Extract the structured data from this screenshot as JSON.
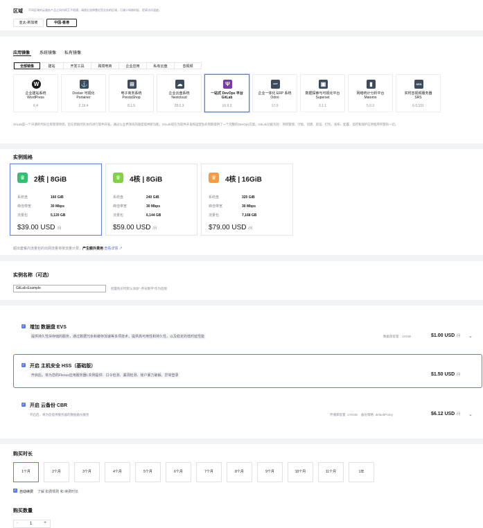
{
  "region": {
    "title": "区域",
    "hint": "不同区域的云服务产品之间内网互不相通；请就近选择靠近您业务的区域，可减少网络时延、提高访问速度。",
    "options": [
      "亚太-新加坡",
      "中国-香港"
    ],
    "selected": "中国-香港"
  },
  "image": {
    "types": [
      "应用镜像",
      "系统镜像",
      "私有镜像"
    ],
    "selected_type": "应用镜像",
    "categories": [
      "全部镜像",
      "建站",
      "开发工具",
      "跨境电商",
      "企业应用",
      "私有云盘",
      "音视频"
    ],
    "selected_category": "全部镜像",
    "items": [
      {
        "name": "企业建站系统",
        "sub": "WordPress",
        "version": "6.4",
        "icon": "wordpress-icon",
        "color": "#191919",
        "glyph": "W"
      },
      {
        "name": "Docker 可视化",
        "sub": "Portainer",
        "version": "2.19.4",
        "icon": "portainer-icon",
        "color": "#3d4b5c",
        "glyph": "⚓"
      },
      {
        "name": "电子商务系统",
        "sub": "PrestaShop",
        "version": "8.1.5",
        "icon": "cart-icon",
        "color": "#3d4b5c",
        "glyph": "🛒"
      },
      {
        "name": "企业云盘系统",
        "sub": "Nextcloud",
        "version": "28.0.3",
        "icon": "cloud-icon",
        "color": "#3d4b5c",
        "glyph": "☁"
      },
      {
        "name": "一站式 DevOps 平台",
        "sub": "GitLab",
        "version": "16.9.3",
        "icon": "gitlab-icon",
        "color": "#7c3aa8",
        "glyph": "Ψ"
      },
      {
        "name": "企业一体化 ERP 系统",
        "sub": "Odoo",
        "version": "17.0",
        "icon": "odoo-icon",
        "color": "#3d4b5c",
        "glyph": "ERP"
      },
      {
        "name": "数据探索与可视化平台",
        "sub": "Superset",
        "version": "3.1.1",
        "icon": "chart-icon",
        "color": "#3d4b5c",
        "glyph": "▣"
      },
      {
        "name": "网络统计分析平台",
        "sub": "Matomo",
        "version": "5.0.3",
        "icon": "analytics-icon",
        "color": "#3d4b5c",
        "glyph": "▮"
      },
      {
        "name": "实时音视频服务器",
        "sub": "SRS",
        "version": "6.0.101",
        "icon": "srs-icon",
        "color": "#3d4b5c",
        "glyph": "SRS"
      }
    ],
    "description": "GitLab是一个开源的代码仓库管理项目，旨在帮助团队协作进行软件开发。通过以业界领先的速度提供新功能，GitLab现在为软件开发和运营生命周期提供了一个完整的DevOps方案。GitLab功能包括：项目管理、计划、创建、验证、打包、发布、配置、监控和保护应用程序所需的一切。"
  },
  "spec": {
    "title": "实例规格",
    "labels": {
      "disk": "系统盘",
      "bandwidth": "峰值带宽",
      "traffic": "流量包",
      "unit": "/月"
    },
    "items": [
      {
        "name": "2核 | 8GiB",
        "disk": "160 GiB",
        "bandwidth": "30 Mbps",
        "traffic": "5,120 GB",
        "price": "$39.00 USD",
        "color": "#2dc26b"
      },
      {
        "name": "4核 | 8GiB",
        "disk": "240 GiB",
        "bandwidth": "30 Mbps",
        "traffic": "6,144 GB",
        "price": "$59.00 USD",
        "color": "#7fd43f"
      },
      {
        "name": "4核 | 16GiB",
        "disk": "320 GiB",
        "bandwidth": "30 Mbps",
        "traffic": "7,168 GB",
        "price": "$79.00 USD",
        "color": "#fa9b3e"
      }
    ],
    "selected": "2核 | 8GiB",
    "note_prefix": "超出套餐内流量包的出网流量将按流量计费，",
    "note_bold": "产生额外费用",
    "note_link": "查看详情"
  },
  "instance_name": {
    "title": "实例名称（可选）",
    "value": "GitLab-Example",
    "hint": "批量购买时默认添加“-序号数字”作为后缀"
  },
  "addons": [
    {
      "title": "增加 数据盘 EVS",
      "desc": "提供持久性块存储的服务，通过数据冗余和缓存加速等多项技术，提供高可用性和持久性，以及稳定的低时延性能",
      "meta": [
        [
          "数据盘容量",
          "10GiB"
        ]
      ],
      "price": "$1.00 USD",
      "unit": "/月",
      "expandable": true
    },
    {
      "title": "开启 主机安全 HSS（基础版）",
      "desc": "开启后，将为您的Flexus应用服务器L实例提供：口令检测、漏洞检测、账户暴力破解、异常登录",
      "meta": [],
      "price": "$1.50 USD",
      "unit": "/月",
      "expandable": false
    },
    {
      "title": "开启 云备份 CBR",
      "desc": "开启后，将为您提供服务器的数据备份服务",
      "meta": [
        [
          "存储库容量",
          "170GiB"
        ],
        [
          "备份策略",
          "defaultPolicy"
        ]
      ],
      "price": "$6.12 USD",
      "unit": "/月",
      "expandable": true
    }
  ],
  "duration": {
    "title": "购买时长",
    "options": [
      "1个月",
      "2个月",
      "3个月",
      "4个月",
      "5个月",
      "6个月",
      "7个月",
      "8个月",
      "9个月",
      "10个月",
      "11个月",
      "1年"
    ],
    "selected": "1个月",
    "auto_renew": "自动续费",
    "renew_link": "了解 扣费规则 和 续费时长"
  },
  "quantity": {
    "title": "购买数量",
    "value": "1",
    "minus": "−",
    "plus": "+"
  }
}
